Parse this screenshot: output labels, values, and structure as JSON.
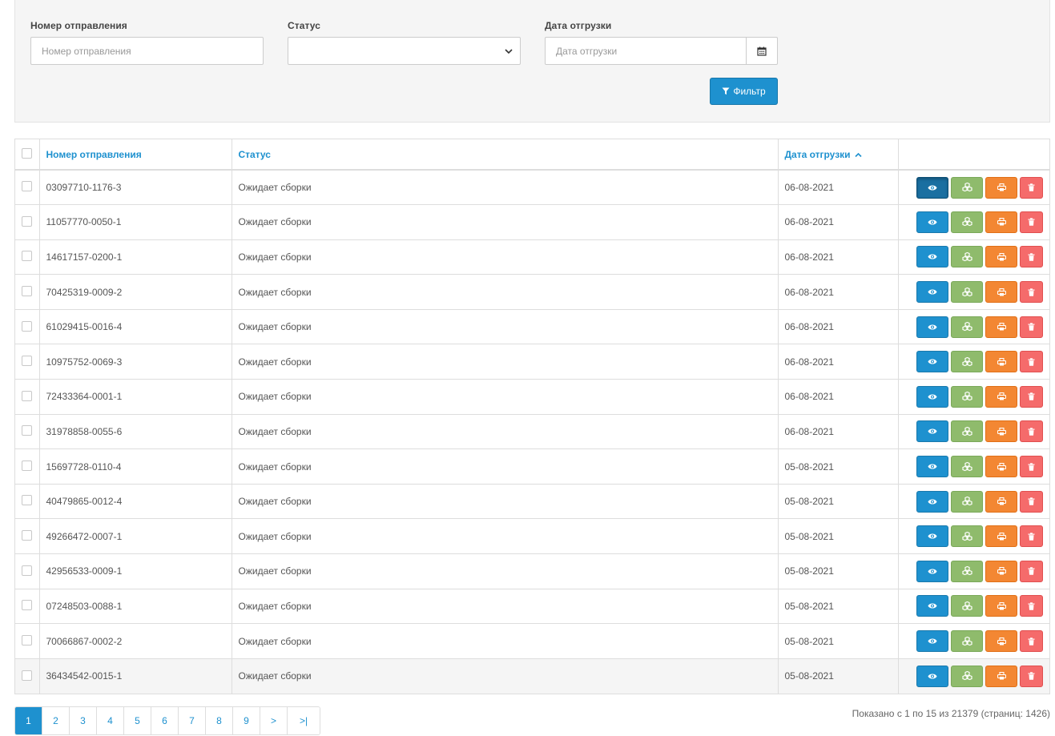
{
  "filter": {
    "shipment_number_label": "Номер отправления",
    "shipment_number_placeholder": "Номер отправления",
    "shipment_number_value": "",
    "status_label": "Статус",
    "status_value": "",
    "ship_date_label": "Дата отгрузки",
    "ship_date_placeholder": "Дата отгрузки",
    "ship_date_value": "",
    "filter_button_label": "Фильтр"
  },
  "table": {
    "headers": {
      "number": "Номер отправления",
      "status": "Статус",
      "date": "Дата отгрузки"
    },
    "sort_column": "date",
    "sort_direction": "asc",
    "rows": [
      {
        "number": "03097710-1176-3",
        "status": "Ожидает сборки",
        "date": "06-08-2021"
      },
      {
        "number": "11057770-0050-1",
        "status": "Ожидает сборки",
        "date": "06-08-2021"
      },
      {
        "number": "14617157-0200-1",
        "status": "Ожидает сборки",
        "date": "06-08-2021"
      },
      {
        "number": "70425319-0009-2",
        "status": "Ожидает сборки",
        "date": "06-08-2021"
      },
      {
        "number": "61029415-0016-4",
        "status": "Ожидает сборки",
        "date": "06-08-2021"
      },
      {
        "number": "10975752-0069-3",
        "status": "Ожидает сборки",
        "date": "06-08-2021"
      },
      {
        "number": "72433364-0001-1",
        "status": "Ожидает сборки",
        "date": "06-08-2021"
      },
      {
        "number": "31978858-0055-6",
        "status": "Ожидает сборки",
        "date": "06-08-2021"
      },
      {
        "number": "15697728-0110-4",
        "status": "Ожидает сборки",
        "date": "05-08-2021"
      },
      {
        "number": "40479865-0012-4",
        "status": "Ожидает сборки",
        "date": "05-08-2021"
      },
      {
        "number": "49266472-0007-1",
        "status": "Ожидает сборки",
        "date": "05-08-2021"
      },
      {
        "number": "42956533-0009-1",
        "status": "Ожидает сборки",
        "date": "05-08-2021"
      },
      {
        "number": "07248503-0088-1",
        "status": "Ожидает сборки",
        "date": "05-08-2021"
      },
      {
        "number": "70066867-0002-2",
        "status": "Ожидает сборки",
        "date": "05-08-2021"
      },
      {
        "number": "36434542-0015-1",
        "status": "Ожидает сборки",
        "date": "05-08-2021"
      }
    ],
    "row_action_icons": [
      "eye-icon",
      "cubes-icon",
      "print-icon",
      "trash-icon"
    ],
    "highlighted_row_index": 14,
    "active_view_row_index": 0
  },
  "pagination": {
    "pages": [
      "1",
      "2",
      "3",
      "4",
      "5",
      "6",
      "7",
      "8",
      "9",
      ">",
      ">|"
    ],
    "current_page": "1",
    "summary": "Показано с 1 по 15 из 21379 (страниц: 1426)"
  },
  "colors": {
    "primary": "#1e91cf",
    "success": "#8fbb6c",
    "warning": "#f38733",
    "danger": "#f56b6b"
  }
}
